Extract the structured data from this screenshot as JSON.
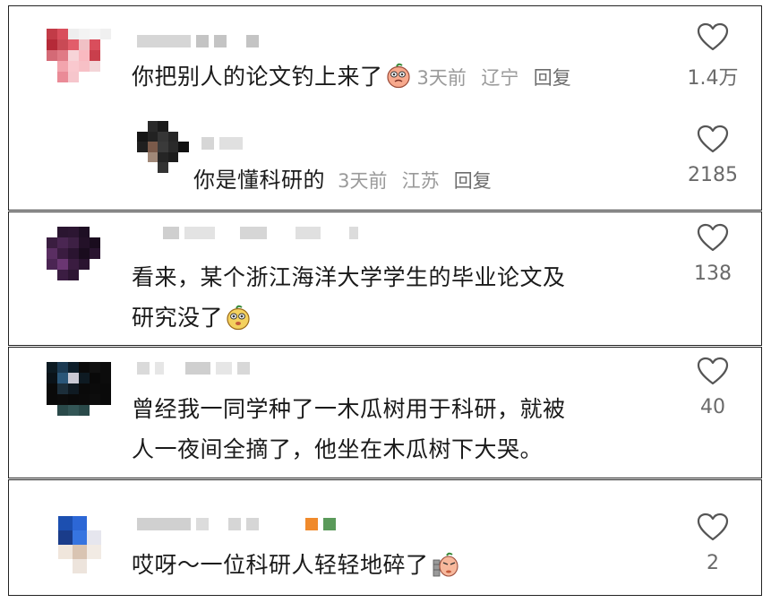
{
  "comments": [
    {
      "text": "你把别人的论文钓上来了",
      "emoji": "peach-face-emoji",
      "time": "3天前",
      "location": "辽宁",
      "reply": "回复",
      "likes": "1.4万",
      "reply_item": {
        "text": "你是懂科研的",
        "time": "3天前",
        "location": "江苏",
        "reply": "回复",
        "likes": "2185"
      }
    },
    {
      "text_line1": "看来，某个浙江海洋大学学生的毕业论文及",
      "text_line2": "研究没了",
      "emoji": "peach-face-emoji",
      "likes": "138"
    },
    {
      "text_line1": "曾经我一同学种了一木瓜树用于科研，就被",
      "text_line2": "人一夜间全摘了，他坐在木瓜树下大哭。",
      "likes": "40"
    },
    {
      "text": "哎呀～一位科研人轻轻地碎了",
      "emoji": "peach-face-wall-emoji",
      "likes": "2"
    }
  ],
  "icons": {
    "like": "heart-outline-icon"
  },
  "colors": {
    "text": "#1a1a1a",
    "meta": "#9a9a9a",
    "border": "#222222"
  }
}
